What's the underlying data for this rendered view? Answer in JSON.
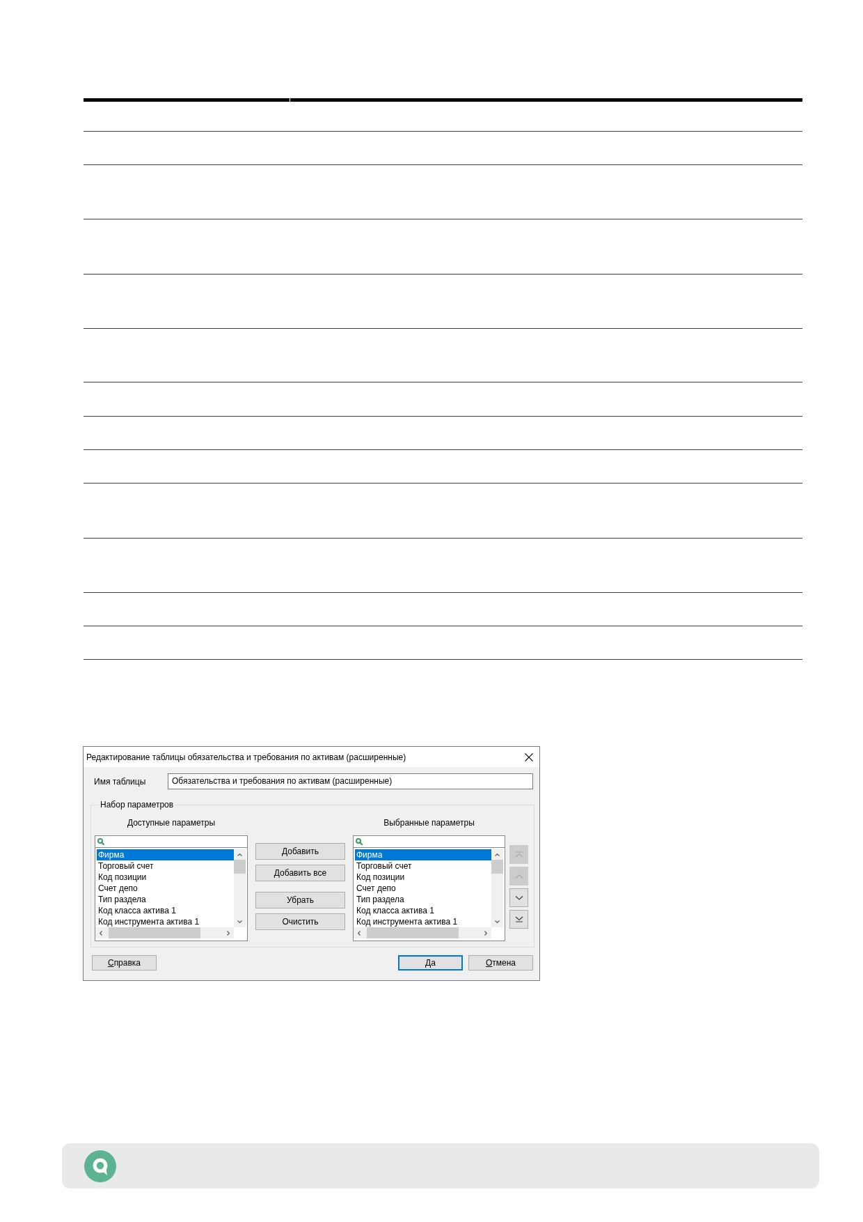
{
  "dialog": {
    "title": "Редактирование таблицы обязательства и требования по активам (расширенные)",
    "table_name": {
      "label": "Имя таблицы",
      "value": "Обязательства и требования по активам (расширенные)"
    },
    "parameter_set": {
      "title": "Набор параметров",
      "available": {
        "title": "Доступные параметры",
        "items": [
          {
            "label": "Фирма",
            "selected": true
          },
          {
            "label": "Торговый счет",
            "selected": false
          },
          {
            "label": "Код позиции",
            "selected": false
          },
          {
            "label": "Счет депо",
            "selected": false
          },
          {
            "label": "Тип раздела",
            "selected": false
          },
          {
            "label": "Код класса актива 1",
            "selected": false
          },
          {
            "label": "Код инструмента актива 1",
            "selected": false
          }
        ]
      },
      "action_groups": [
        {
          "buttons": [
            {
              "label": "Добавить"
            },
            {
              "label": "Добавить все"
            }
          ]
        },
        {
          "buttons": [
            {
              "label": "Убрать"
            },
            {
              "label": "Очистить"
            }
          ]
        }
      ],
      "chosen": {
        "title": "Выбранные параметры",
        "items": [
          {
            "label": "Фирма",
            "selected": true
          },
          {
            "label": "Торговый счет",
            "selected": false
          },
          {
            "label": "Код позиции",
            "selected": false
          },
          {
            "label": "Счет депо",
            "selected": false
          },
          {
            "label": "Тип раздела",
            "selected": false
          },
          {
            "label": "Код класса актива 1",
            "selected": false
          },
          {
            "label": "Код инструмента актива 1",
            "selected": false
          }
        ]
      },
      "move_buttons": [
        {
          "kind": "top",
          "disabled": true
        },
        {
          "kind": "up",
          "disabled": true
        },
        {
          "kind": "down",
          "disabled": false
        },
        {
          "kind": "bottom",
          "disabled": false
        }
      ]
    },
    "left_buttons": [
      {
        "label": "Справка",
        "access_key": true,
        "default": false
      }
    ],
    "right_buttons": [
      {
        "label": "Да",
        "access_key": true,
        "default": true
      },
      {
        "label": "Отмена",
        "access_key": true,
        "default": false
      }
    ]
  }
}
